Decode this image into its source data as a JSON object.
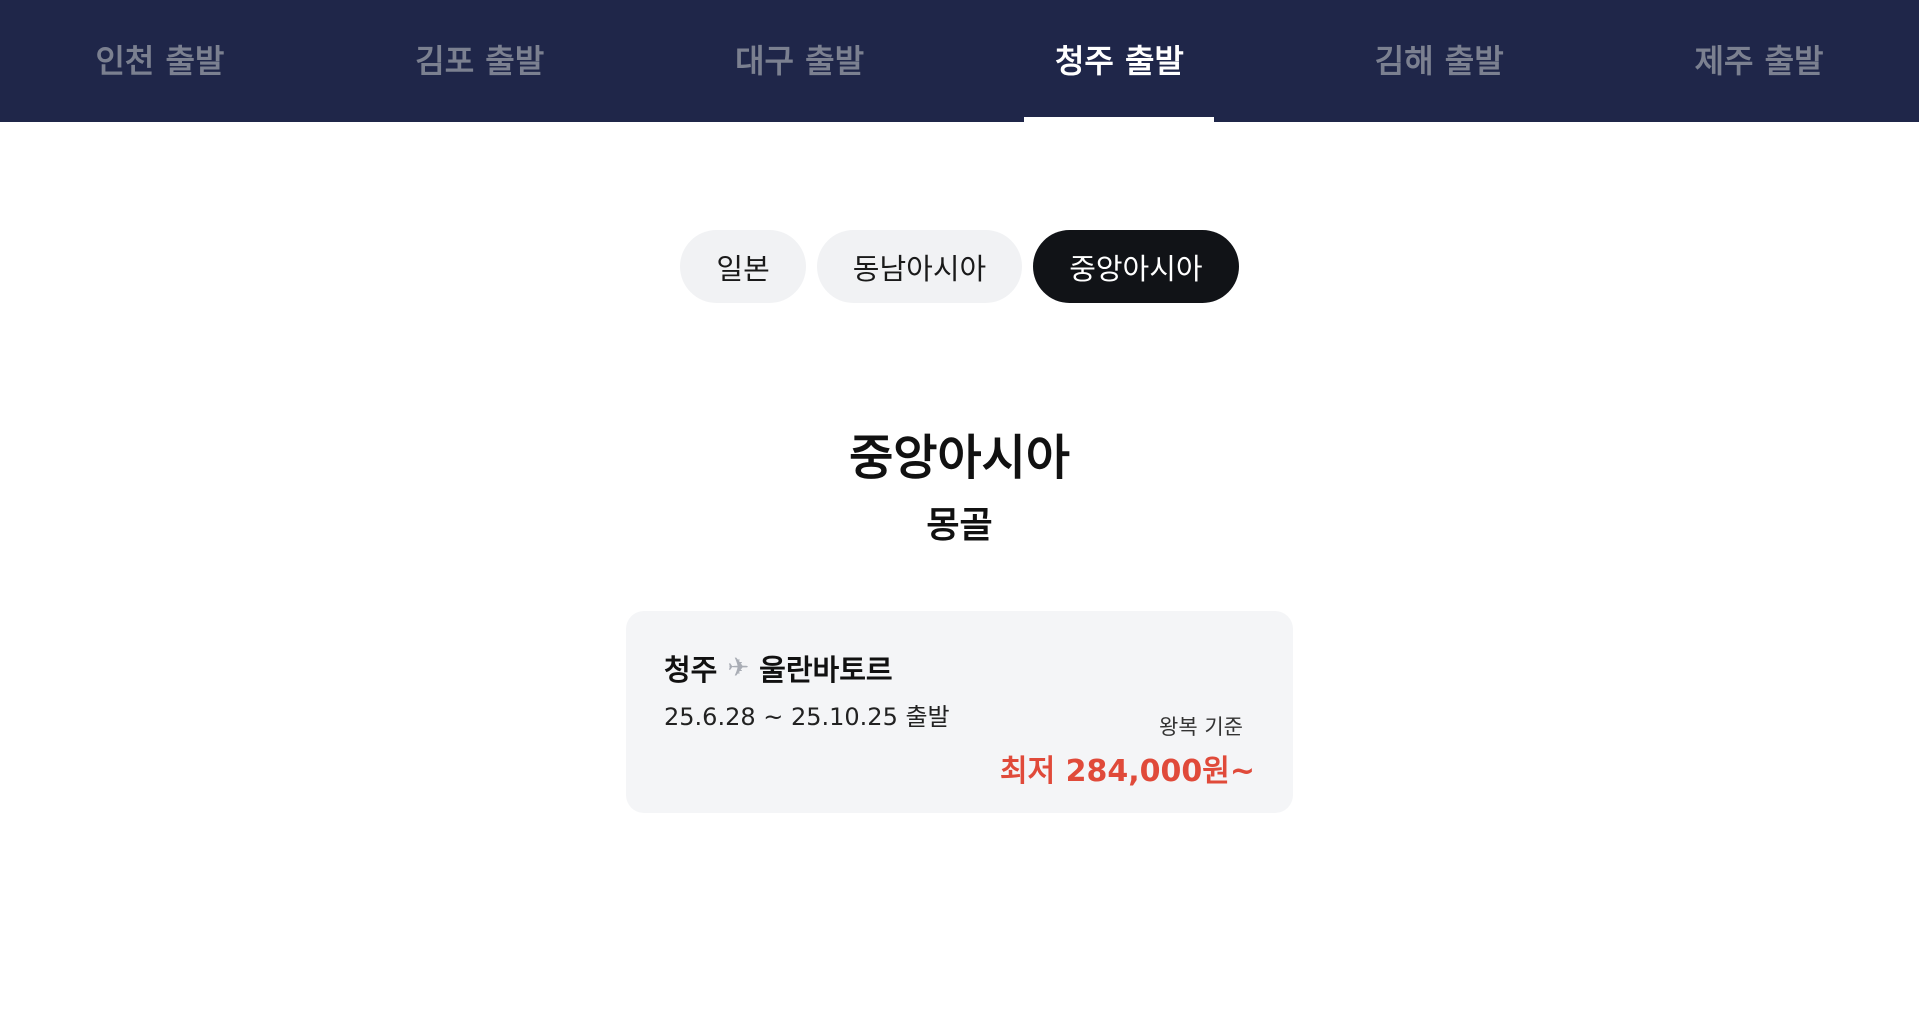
{
  "departure_tabs": [
    {
      "label": "인천 출발",
      "active": false
    },
    {
      "label": "김포 출발",
      "active": false
    },
    {
      "label": "대구 출발",
      "active": false
    },
    {
      "label": "청주 출발",
      "active": true
    },
    {
      "label": "김해 출발",
      "active": false
    },
    {
      "label": "제주 출발",
      "active": false
    }
  ],
  "region_chips": [
    {
      "label": "일본",
      "active": false
    },
    {
      "label": "동남아시아",
      "active": false
    },
    {
      "label": "중앙아시아",
      "active": true
    }
  ],
  "region_title": "중앙아시아",
  "country_title": "몽골",
  "route_card": {
    "origin": "청주",
    "plane_icon": "plane-icon",
    "destination": "울란바토르",
    "period": "25.6.28 ~ 25.10.25 출발",
    "basis": "왕복 기준",
    "price": "최저 284,000원~"
  },
  "colors": {
    "nav_bg": "#1f2649",
    "nav_inactive_text": "#7b8090",
    "chip_active_bg": "#111317",
    "chip_bg": "#f1f2f4",
    "card_bg": "#f4f5f7",
    "price": "#e04a3a"
  }
}
